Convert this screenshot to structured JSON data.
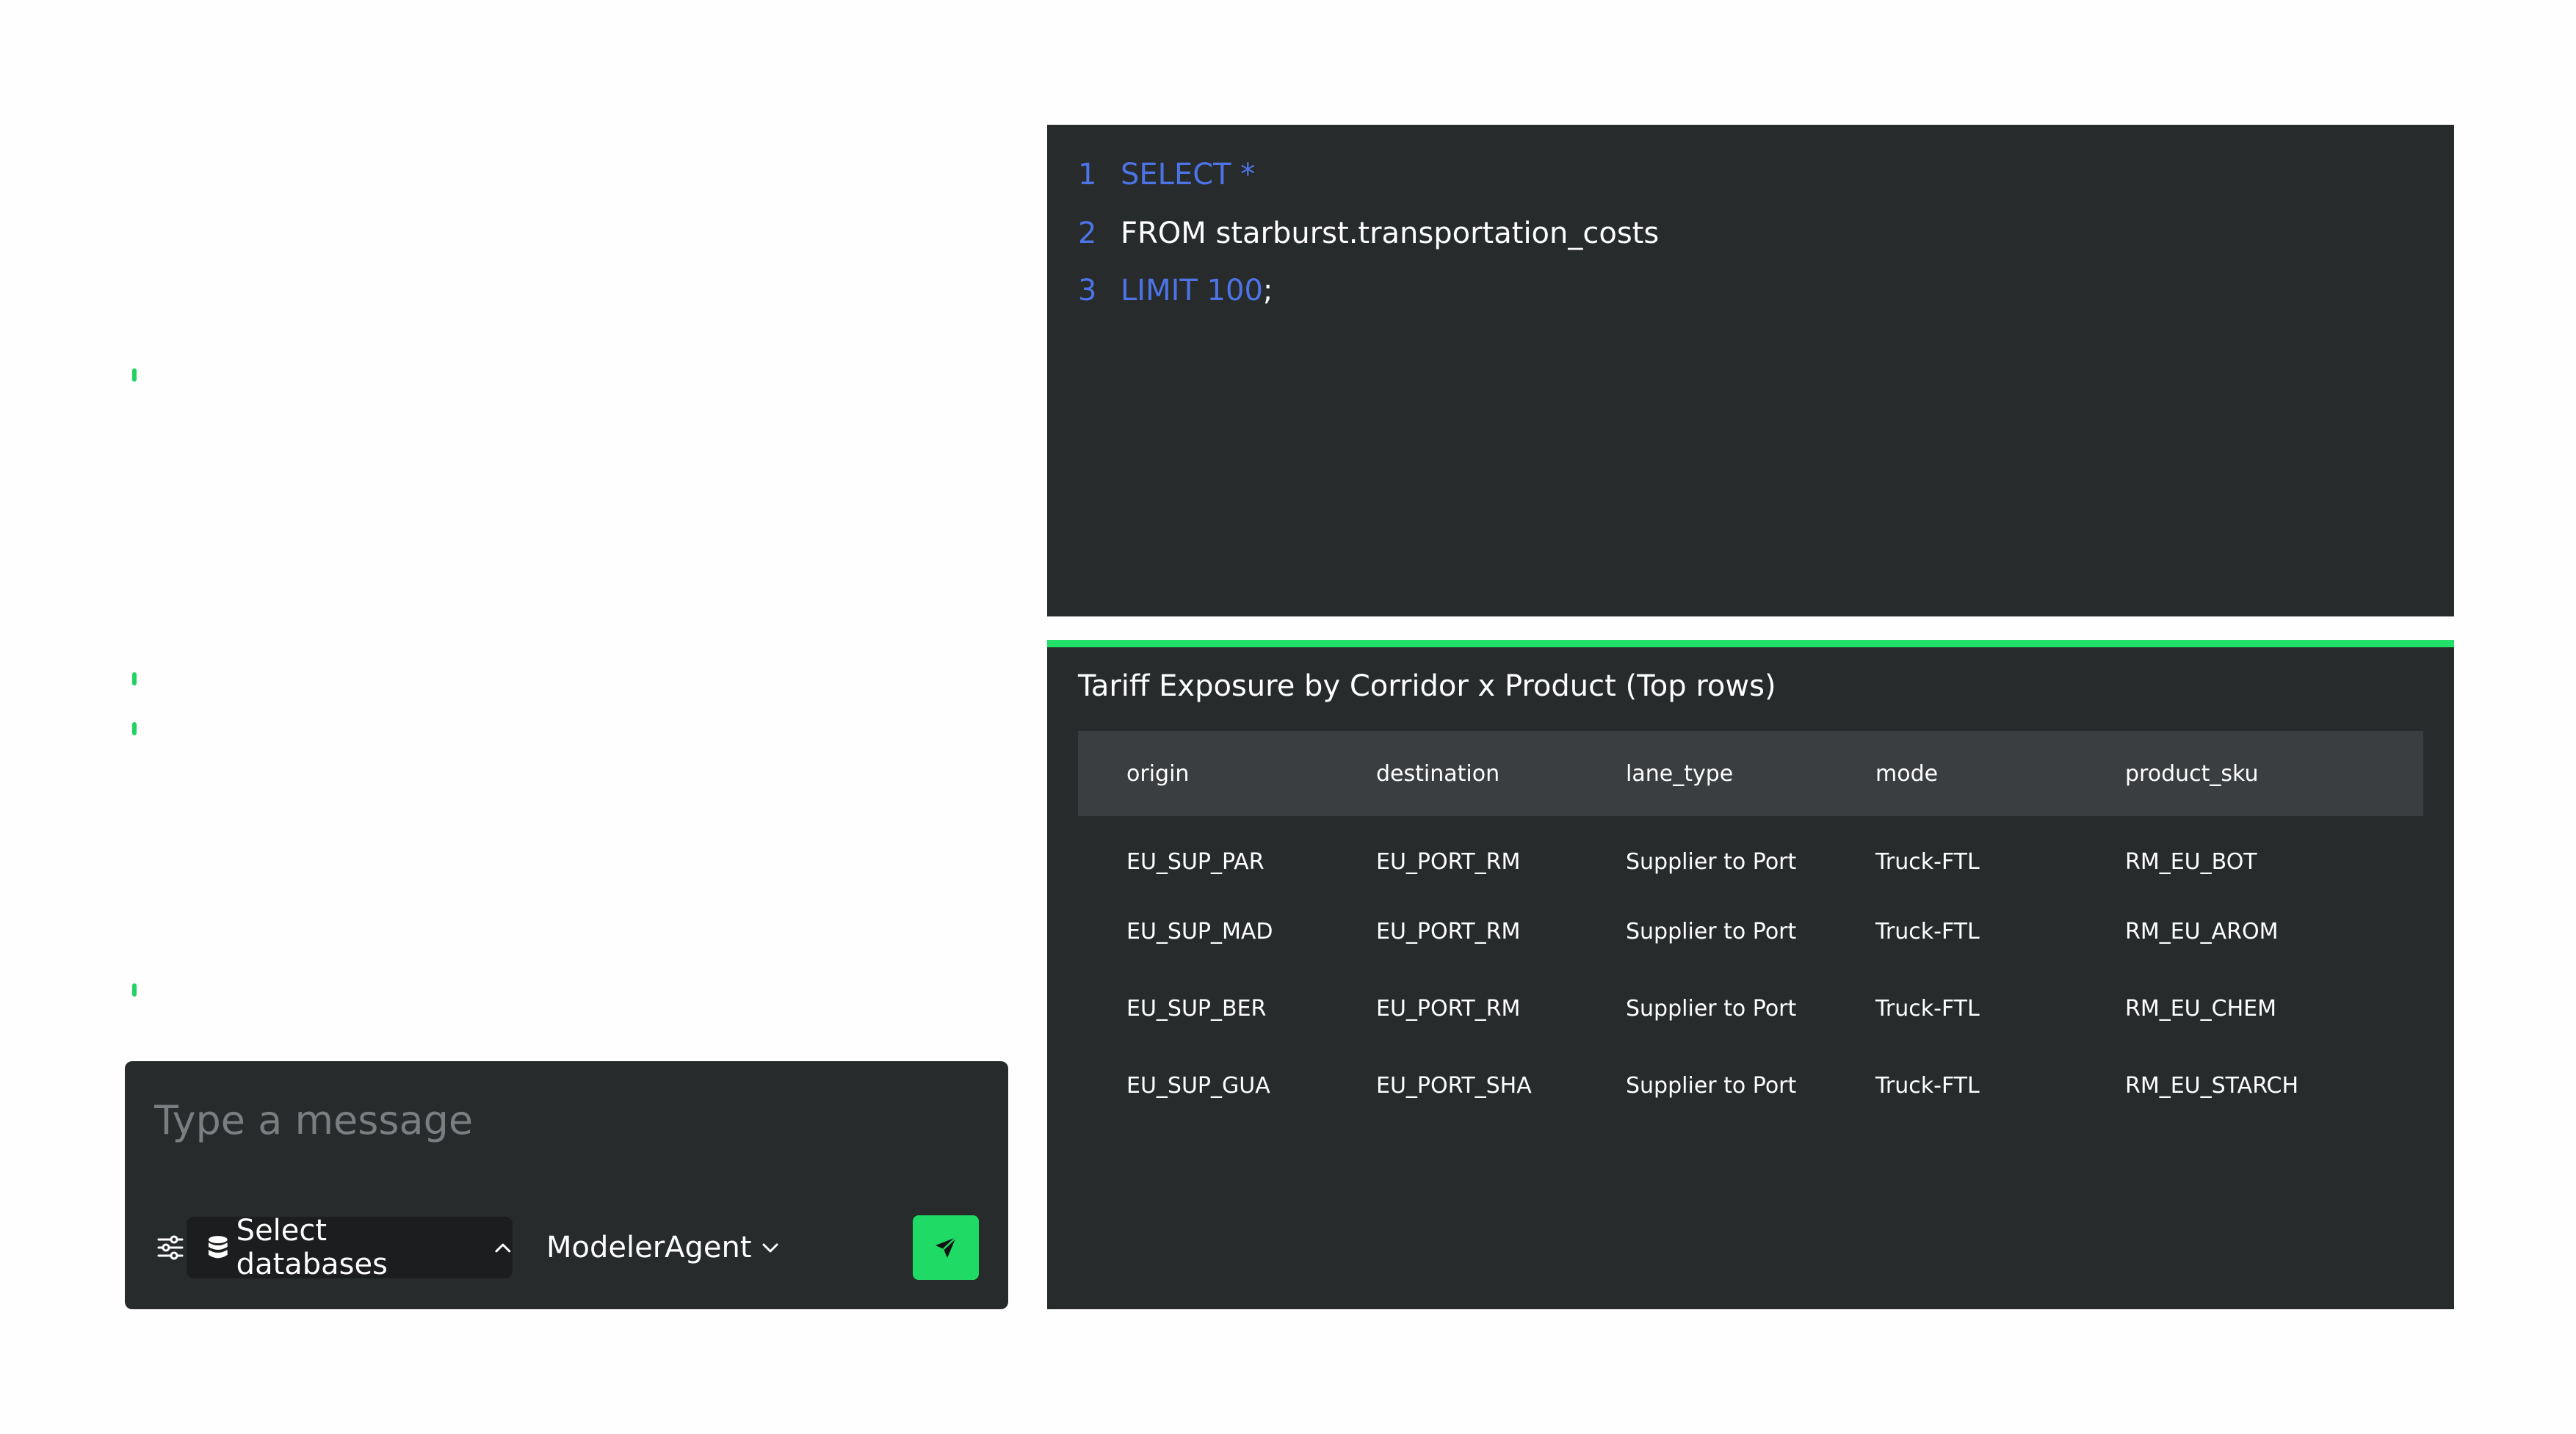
{
  "composer": {
    "placeholder": "Type a message",
    "db_select_label": "Select databases",
    "agent_label": "ModelerAgent"
  },
  "editor": {
    "lines": [
      {
        "number": "1",
        "keyword": "SELECT *",
        "rest": "",
        "suffix": ""
      },
      {
        "number": "2",
        "keyword": "",
        "rest": "FROM starburst.transportation_costs",
        "suffix": ""
      },
      {
        "number": "3",
        "keyword": "LIMIT 100",
        "rest": "",
        "suffix": ";"
      }
    ]
  },
  "results": {
    "title": "Tariff Exposure by Corridor x Product (Top rows)",
    "columns": [
      "origin",
      "destination",
      "lane_type",
      "mode",
      "product_sku"
    ],
    "rows": [
      [
        "EU_SUP_PAR",
        "EU_PORT_RM",
        "Supplier to Port",
        "Truck-FTL",
        "RM_EU_BOT"
      ],
      [
        "EU_SUP_MAD",
        "EU_PORT_RM",
        "Supplier to Port",
        "Truck-FTL",
        "RM_EU_AROM"
      ],
      [
        "EU_SUP_BER",
        "EU_PORT_RM",
        "Supplier to Port",
        "Truck-FTL",
        "RM_EU_CHEM"
      ],
      [
        "EU_SUP_GUA",
        "EU_PORT_SHA",
        "Supplier to Port",
        "Truck-FTL",
        "RM_EU_STARCH"
      ]
    ]
  },
  "colors": {
    "accent": "#20da66",
    "panel_bg": "#282b2c",
    "keyword": "#4d74e6"
  }
}
